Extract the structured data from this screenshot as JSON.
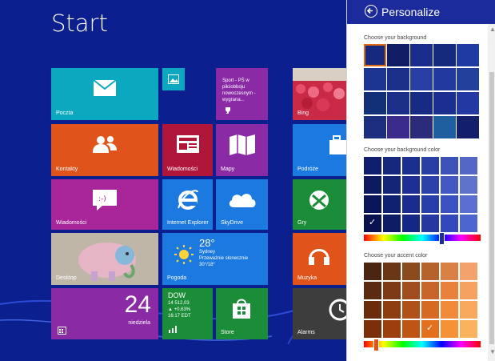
{
  "start": {
    "title": "Start"
  },
  "tiles": {
    "mail": {
      "label": "Poczta"
    },
    "contacts": {
      "label": "Kontakty"
    },
    "news": {
      "label": "Wiadomości"
    },
    "maps": {
      "label": "Mapy"
    },
    "messaging": {
      "label": "Wiadomości"
    },
    "ie": {
      "label": "Internet Explorer"
    },
    "skydrive": {
      "label": "SkyDrive"
    },
    "desktop": {
      "label": "Desktop"
    },
    "weather": {
      "label": "Pogoda",
      "temp": "28°",
      "city": "Sydney",
      "condition": "Przeważnie słonecznie",
      "range": "30°/18°"
    },
    "calendar": {
      "day": "24",
      "weekday": "niedziela"
    },
    "finance": {
      "index": "DOW",
      "value": "14 512,03",
      "change": "▲ +0,63%",
      "time": "16:17 EDT"
    },
    "store": {
      "label": "Store"
    },
    "sport": {
      "lines": [
        "Sport - PŚ w",
        "piłciobboju",
        "nowoczesnym -",
        "wygrana..."
      ]
    },
    "bing": {
      "label": "Bing"
    },
    "travel": {
      "label": "Podróże"
    },
    "games": {
      "label": "Gry"
    },
    "music": {
      "label": "Muzyka"
    },
    "alarms": {
      "label": "Alarms"
    }
  },
  "panel": {
    "title": "Personalize",
    "background_label": "Choose your background",
    "bg_color_label": "Choose your background color",
    "accent_label": "Choose your accent color",
    "bg_colors": [
      "#0f1f6e",
      "#16277e",
      "#1b2f8f",
      "#2a3fa3",
      "#3d52b6",
      "#5567c6",
      "#0d1a60",
      "#142578",
      "#1d2f94",
      "#2d41ab",
      "#4358c0",
      "#6073cc",
      "#0a155a",
      "#102170",
      "#1a2c8e",
      "#283ea9",
      "#3a52c1",
      "#5a6fd0",
      "#08124f",
      "#0c1c66",
      "#152784",
      "#2538a2",
      "#3349bb",
      "#4d66cf"
    ],
    "accent_colors": [
      "#4a2612",
      "#6b3616",
      "#8c4a1f",
      "#b5622b",
      "#d98045",
      "#f2a26a",
      "#5c2a10",
      "#7e3a14",
      "#a04c1c",
      "#c86427",
      "#e8813e",
      "#f6a061",
      "#6b2c0d",
      "#8e3d11",
      "#b05119",
      "#d66a23",
      "#f08a3a",
      "#f9a95e",
      "#7a2e0a",
      "#9c3f0d",
      "#bf5514",
      "#e4701e",
      "#f59136",
      "#fbb25c"
    ]
  }
}
